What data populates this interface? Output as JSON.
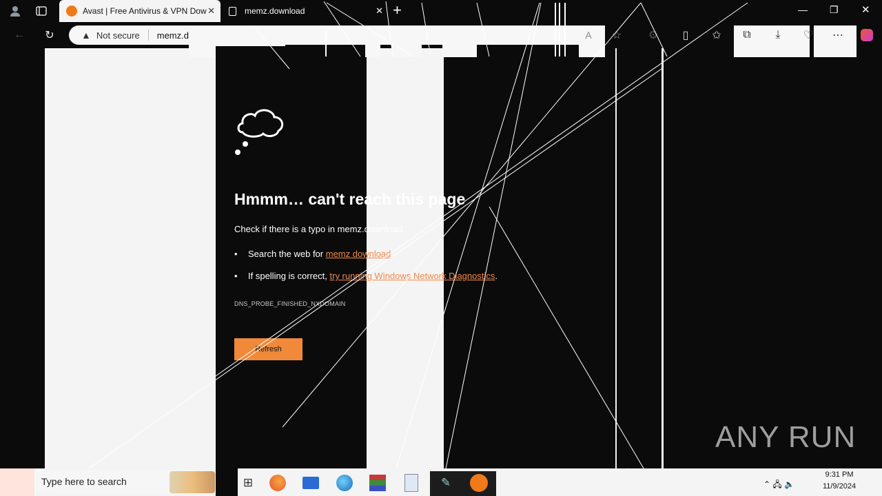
{
  "browser": {
    "tabs": [
      {
        "label": "Avast | Free Antivirus & VPN Dow",
        "icon": "avast-icon"
      },
      {
        "label": "memz.download",
        "icon": "page-error-icon"
      }
    ],
    "new_tab": "+",
    "security_label": "Not secure",
    "url": "memz.download"
  },
  "error_page": {
    "title": "Hmmm… can't reach this page",
    "message": "Check if there is a typo in memz.download.",
    "bullet1_prefix": "Search the web for ",
    "bullet1_link": "memz download",
    "bullet2_prefix": "If spelling is correct, ",
    "bullet2_link": "try running Windows Network Diagnostics",
    "bullet2_suffix": ".",
    "code": "DNS_PROBE_FINISHED_NXDOMAIN",
    "refresh": "Refresh"
  },
  "taskbar": {
    "search_placeholder": "Type here to search",
    "time": "9:31 PM",
    "date": "11/9/2024"
  },
  "watermark": "ANY RUN",
  "colors": {
    "accent": "#f0893a",
    "link": "#f0894a",
    "background": "#0b0b0b"
  }
}
